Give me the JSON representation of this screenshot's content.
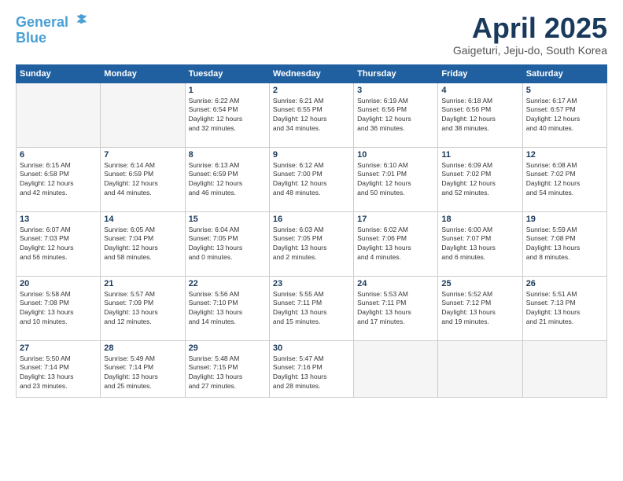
{
  "header": {
    "logo_line1": "General",
    "logo_line2": "Blue",
    "month_title": "April 2025",
    "location": "Gaigeturi, Jeju-do, South Korea"
  },
  "weekdays": [
    "Sunday",
    "Monday",
    "Tuesday",
    "Wednesday",
    "Thursday",
    "Friday",
    "Saturday"
  ],
  "days": [
    {
      "num": "",
      "info": ""
    },
    {
      "num": "",
      "info": ""
    },
    {
      "num": "1",
      "info": "Sunrise: 6:22 AM\nSunset: 6:54 PM\nDaylight: 12 hours\nand 32 minutes."
    },
    {
      "num": "2",
      "info": "Sunrise: 6:21 AM\nSunset: 6:55 PM\nDaylight: 12 hours\nand 34 minutes."
    },
    {
      "num": "3",
      "info": "Sunrise: 6:19 AM\nSunset: 6:56 PM\nDaylight: 12 hours\nand 36 minutes."
    },
    {
      "num": "4",
      "info": "Sunrise: 6:18 AM\nSunset: 6:56 PM\nDaylight: 12 hours\nand 38 minutes."
    },
    {
      "num": "5",
      "info": "Sunrise: 6:17 AM\nSunset: 6:57 PM\nDaylight: 12 hours\nand 40 minutes."
    },
    {
      "num": "6",
      "info": "Sunrise: 6:15 AM\nSunset: 6:58 PM\nDaylight: 12 hours\nand 42 minutes."
    },
    {
      "num": "7",
      "info": "Sunrise: 6:14 AM\nSunset: 6:59 PM\nDaylight: 12 hours\nand 44 minutes."
    },
    {
      "num": "8",
      "info": "Sunrise: 6:13 AM\nSunset: 6:59 PM\nDaylight: 12 hours\nand 46 minutes."
    },
    {
      "num": "9",
      "info": "Sunrise: 6:12 AM\nSunset: 7:00 PM\nDaylight: 12 hours\nand 48 minutes."
    },
    {
      "num": "10",
      "info": "Sunrise: 6:10 AM\nSunset: 7:01 PM\nDaylight: 12 hours\nand 50 minutes."
    },
    {
      "num": "11",
      "info": "Sunrise: 6:09 AM\nSunset: 7:02 PM\nDaylight: 12 hours\nand 52 minutes."
    },
    {
      "num": "12",
      "info": "Sunrise: 6:08 AM\nSunset: 7:02 PM\nDaylight: 12 hours\nand 54 minutes."
    },
    {
      "num": "13",
      "info": "Sunrise: 6:07 AM\nSunset: 7:03 PM\nDaylight: 12 hours\nand 56 minutes."
    },
    {
      "num": "14",
      "info": "Sunrise: 6:05 AM\nSunset: 7:04 PM\nDaylight: 12 hours\nand 58 minutes."
    },
    {
      "num": "15",
      "info": "Sunrise: 6:04 AM\nSunset: 7:05 PM\nDaylight: 13 hours\nand 0 minutes."
    },
    {
      "num": "16",
      "info": "Sunrise: 6:03 AM\nSunset: 7:05 PM\nDaylight: 13 hours\nand 2 minutes."
    },
    {
      "num": "17",
      "info": "Sunrise: 6:02 AM\nSunset: 7:06 PM\nDaylight: 13 hours\nand 4 minutes."
    },
    {
      "num": "18",
      "info": "Sunrise: 6:00 AM\nSunset: 7:07 PM\nDaylight: 13 hours\nand 6 minutes."
    },
    {
      "num": "19",
      "info": "Sunrise: 5:59 AM\nSunset: 7:08 PM\nDaylight: 13 hours\nand 8 minutes."
    },
    {
      "num": "20",
      "info": "Sunrise: 5:58 AM\nSunset: 7:08 PM\nDaylight: 13 hours\nand 10 minutes."
    },
    {
      "num": "21",
      "info": "Sunrise: 5:57 AM\nSunset: 7:09 PM\nDaylight: 13 hours\nand 12 minutes."
    },
    {
      "num": "22",
      "info": "Sunrise: 5:56 AM\nSunset: 7:10 PM\nDaylight: 13 hours\nand 14 minutes."
    },
    {
      "num": "23",
      "info": "Sunrise: 5:55 AM\nSunset: 7:11 PM\nDaylight: 13 hours\nand 15 minutes."
    },
    {
      "num": "24",
      "info": "Sunrise: 5:53 AM\nSunset: 7:11 PM\nDaylight: 13 hours\nand 17 minutes."
    },
    {
      "num": "25",
      "info": "Sunrise: 5:52 AM\nSunset: 7:12 PM\nDaylight: 13 hours\nand 19 minutes."
    },
    {
      "num": "26",
      "info": "Sunrise: 5:51 AM\nSunset: 7:13 PM\nDaylight: 13 hours\nand 21 minutes."
    },
    {
      "num": "27",
      "info": "Sunrise: 5:50 AM\nSunset: 7:14 PM\nDaylight: 13 hours\nand 23 minutes."
    },
    {
      "num": "28",
      "info": "Sunrise: 5:49 AM\nSunset: 7:14 PM\nDaylight: 13 hours\nand 25 minutes."
    },
    {
      "num": "29",
      "info": "Sunrise: 5:48 AM\nSunset: 7:15 PM\nDaylight: 13 hours\nand 27 minutes."
    },
    {
      "num": "30",
      "info": "Sunrise: 5:47 AM\nSunset: 7:16 PM\nDaylight: 13 hours\nand 28 minutes."
    },
    {
      "num": "",
      "info": ""
    },
    {
      "num": "",
      "info": ""
    },
    {
      "num": "",
      "info": ""
    }
  ]
}
